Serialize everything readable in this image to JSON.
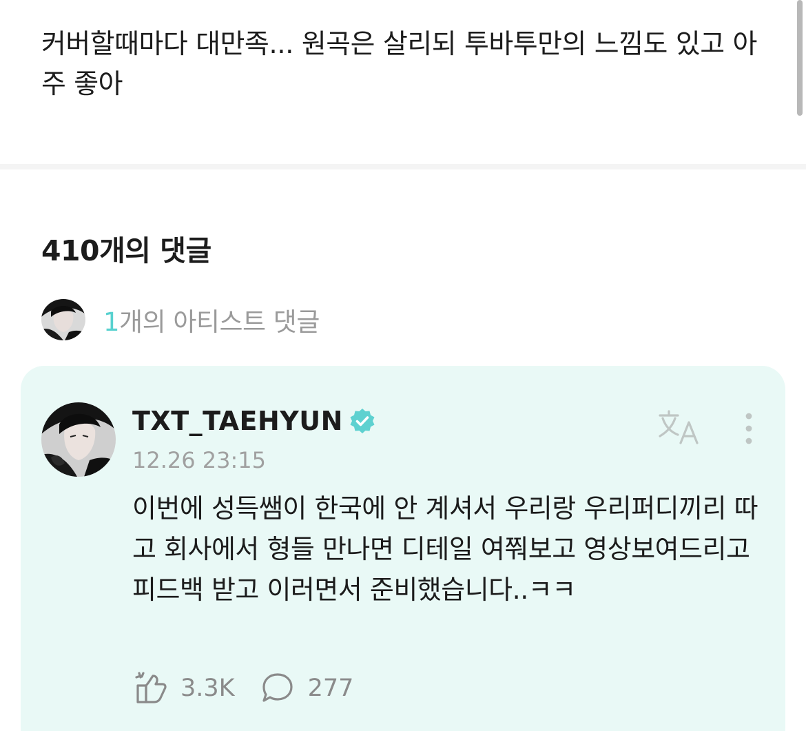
{
  "post": {
    "text": "커버할때마다 대만족... 원곡은 살리되 투바투만의 느낌도 있고 아주 좋아"
  },
  "comments": {
    "title": "410개의 댓글",
    "artist_summary": {
      "count": "1",
      "label": "개의 아티스트 댓글"
    }
  },
  "artist_comment": {
    "author": "TXT_TAEHYUN",
    "timestamp": "12.26 23:15",
    "body": "이번에 성득쌤이 한국에 안 계셔서 우리랑 우리퍼디끼리 따고 회사에서 형들 만나면 디테일 여쭤보고 영상보여드리고 피드백 받고 이러면서 준비했습니다..ㅋㅋ",
    "like_count": "3.3K",
    "reply_count": "277",
    "icons": {
      "verified": "verified-badge-icon",
      "translate": "translate-icon",
      "more": "more-vertical-icon",
      "like": "like-icon",
      "reply": "reply-bubble-icon"
    }
  },
  "colors": {
    "accent": "#58d1cf",
    "card_background": "#e9f9f6",
    "muted_text": "#9a9a9a"
  }
}
